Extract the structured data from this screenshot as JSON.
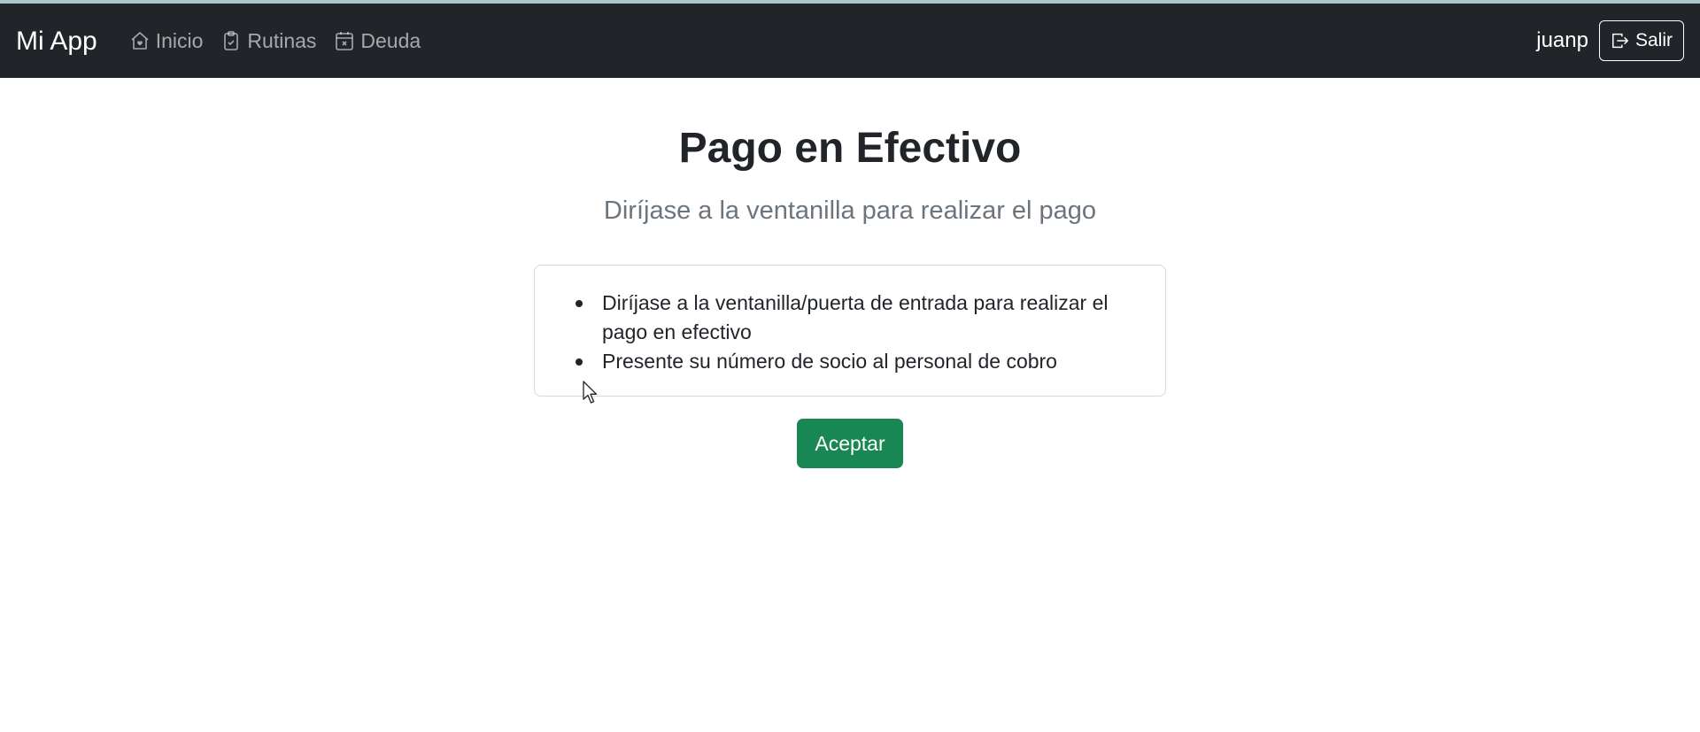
{
  "navbar": {
    "brand": "Mi App",
    "links": [
      {
        "label": "Inicio",
        "icon": "home-heart-icon"
      },
      {
        "label": "Rutinas",
        "icon": "clipboard-check-icon"
      },
      {
        "label": "Deuda",
        "icon": "calendar-x-icon"
      }
    ],
    "username": "juanp",
    "logout_label": "Salir",
    "logout_icon": "box-arrow-right-icon"
  },
  "main": {
    "title": "Pago en Efectivo",
    "subtitle": "Diríjase a la ventanilla para realizar el pago",
    "instructions": [
      "Diríjase a la ventanilla/puerta de entrada para realizar el pago en efectivo",
      "Presente su número de socio al personal de cobro"
    ],
    "accept_label": "Aceptar"
  },
  "colors": {
    "navbar_bg": "#212529",
    "accept_button": "#198754",
    "subtitle_text": "#6c757d"
  }
}
